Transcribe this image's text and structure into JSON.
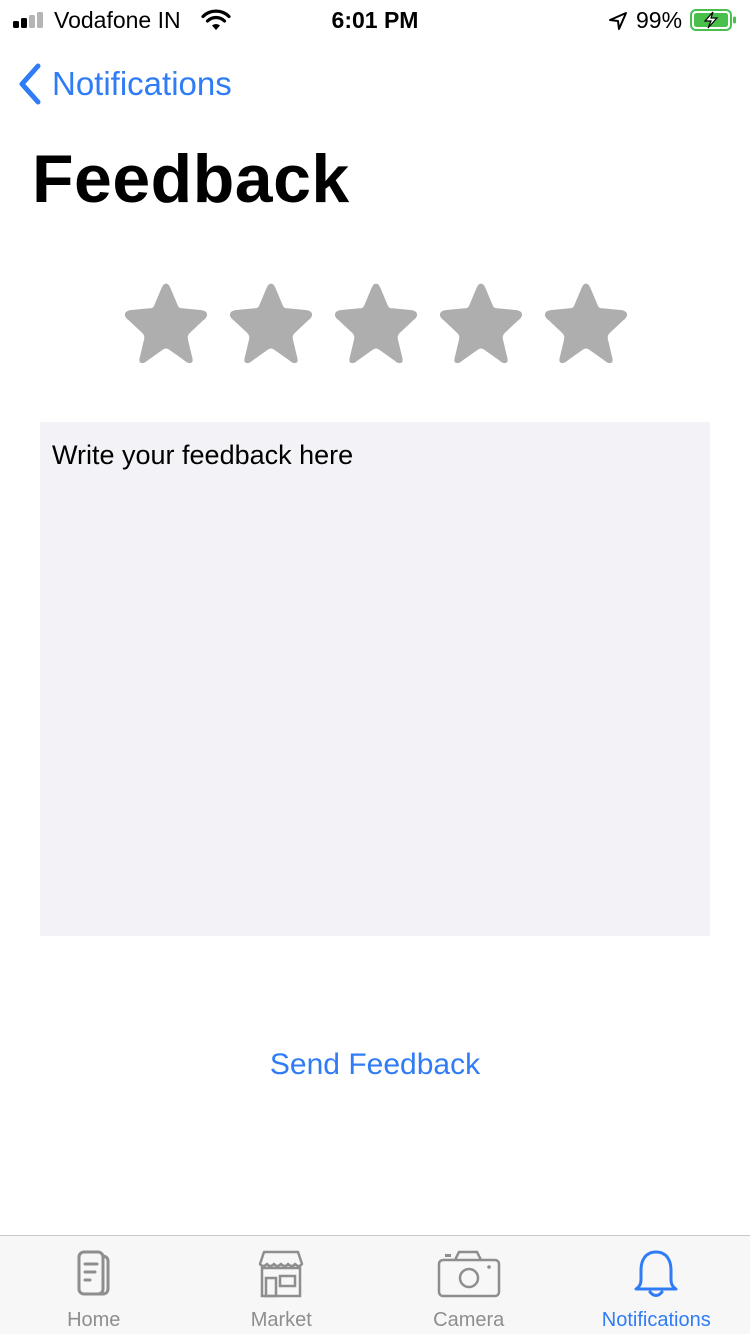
{
  "status_bar": {
    "carrier": "Vodafone IN",
    "time": "6:01 PM",
    "battery": "99%",
    "signal_icon": "cellular-signal-icon",
    "wifi_icon": "wifi-icon",
    "location_icon": "location-arrow-icon",
    "battery_icon": "battery-charging-icon"
  },
  "nav": {
    "back_label": "Notifications",
    "back_icon": "chevron-left-icon"
  },
  "page": {
    "title": "Feedback"
  },
  "rating": {
    "max": 5,
    "value": 0,
    "star_icon": "star-icon",
    "star_color": "#aeaeae"
  },
  "feedback": {
    "placeholder": "Write your feedback here"
  },
  "actions": {
    "send_label": "Send Feedback"
  },
  "tab_bar": {
    "tabs": [
      {
        "label": "Home",
        "icon": "home-icon",
        "active": false
      },
      {
        "label": "Market",
        "icon": "market-icon",
        "active": false
      },
      {
        "label": "Camera",
        "icon": "camera-icon",
        "active": false
      },
      {
        "label": "Notifications",
        "icon": "bell-icon",
        "active": true
      }
    ]
  },
  "colors": {
    "accent": "#2f7cf6",
    "inactive": "#8e8e8e",
    "input_background": "#f2f2f7"
  }
}
